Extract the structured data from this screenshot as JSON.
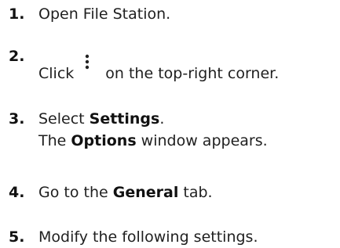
{
  "steps": [
    {
      "number": "1.",
      "text": "Open File Station."
    },
    {
      "number": "2.",
      "before": "Click",
      "icon": "kebab-menu-icon",
      "after": "on the top-right corner."
    },
    {
      "number": "3.",
      "prefix": "Select ",
      "bold": "Settings",
      "suffix": ".",
      "line2_prefix": "The ",
      "line2_bold": "Options",
      "line2_suffix": " window appears."
    },
    {
      "number": "4.",
      "prefix": "Go to the ",
      "bold": "General",
      "suffix": " tab."
    },
    {
      "number": "5.",
      "text": "Modify the following settings."
    }
  ]
}
